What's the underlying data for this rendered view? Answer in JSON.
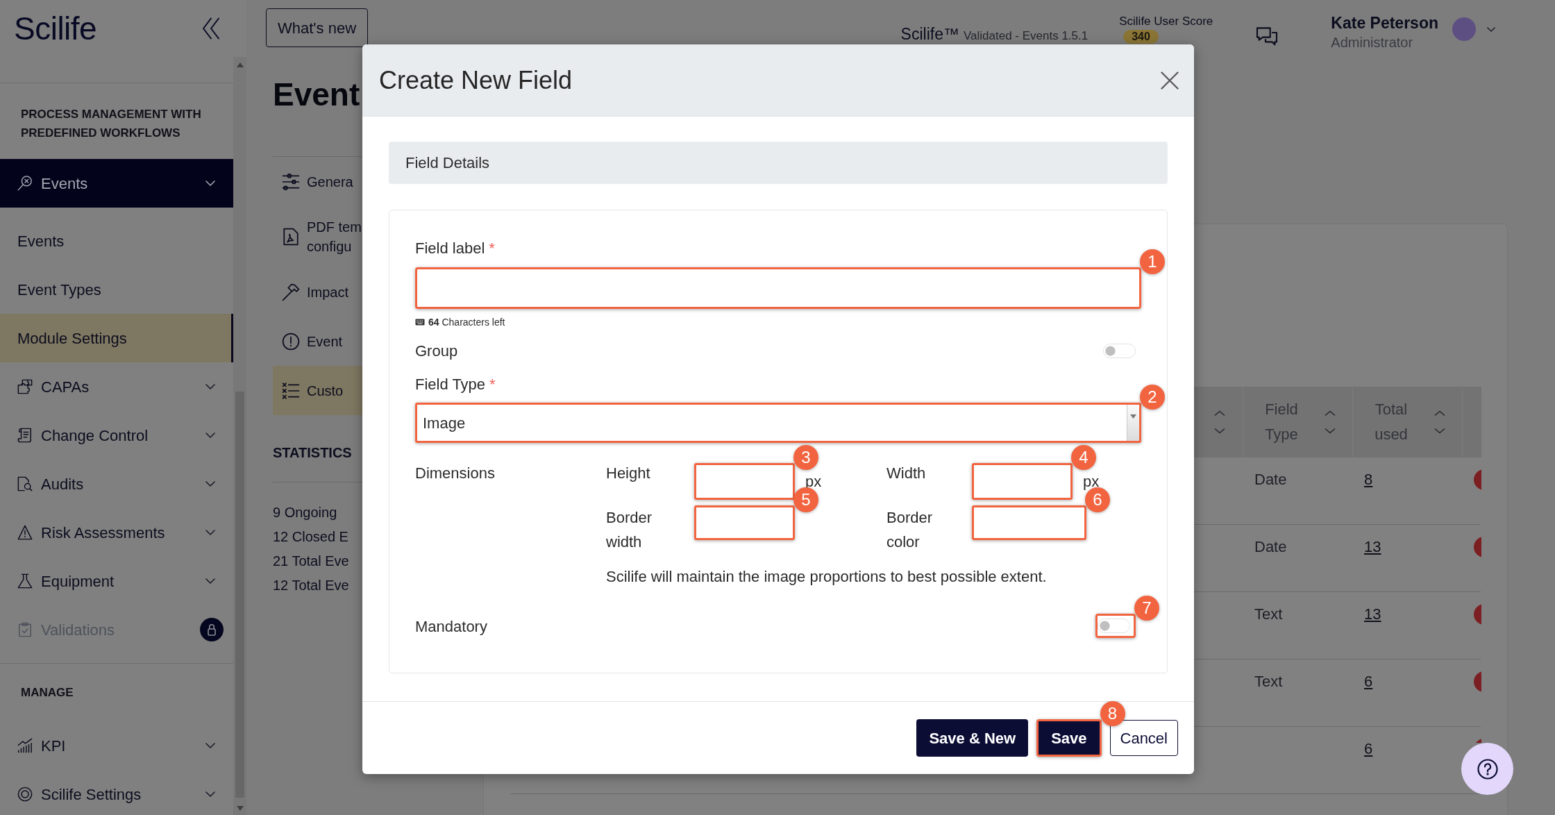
{
  "sidebar": {
    "logo": "Scilife",
    "sections": [
      {
        "title": "PROCESS MANAGEMENT WITH PREDEFINED WORKFLOWS",
        "items": [
          {
            "kind": "module",
            "label": "Events",
            "selected": true,
            "disabled": false
          },
          {
            "kind": "subitem",
            "label": "Events",
            "selected": false,
            "disabled": false
          },
          {
            "kind": "subitem",
            "label": "Event Types",
            "selected": false,
            "disabled": false
          },
          {
            "kind": "subitem",
            "label": "Module Settings",
            "selected": true,
            "disabled": false
          },
          {
            "kind": "module",
            "label": "CAPAs",
            "selected": false,
            "disabled": false
          },
          {
            "kind": "module",
            "label": "Change Control",
            "selected": false,
            "disabled": false
          },
          {
            "kind": "module",
            "label": "Audits",
            "selected": false,
            "disabled": false
          },
          {
            "kind": "module",
            "label": "Risk Assessments",
            "selected": false,
            "disabled": false
          },
          {
            "kind": "module",
            "label": "Equipment",
            "selected": false,
            "disabled": false
          },
          {
            "kind": "locked",
            "label": "Validations",
            "selected": false,
            "disabled": true
          }
        ]
      },
      {
        "title": "MANAGE",
        "items": [
          {
            "kind": "module",
            "label": "KPI",
            "selected": false,
            "disabled": false
          },
          {
            "kind": "module",
            "label": "Scilife Settings",
            "selected": false,
            "disabled": false
          }
        ]
      }
    ]
  },
  "topbar": {
    "whats_new": "What's new",
    "product": "Scilife™",
    "version": "Validated - Events 1.5.1",
    "score_label": "Scilife User Score",
    "score": "340",
    "user": {
      "name": "Kate Peterson",
      "role": "Administrator"
    }
  },
  "page": {
    "title": "Event",
    "nav": [
      {
        "lines": [
          "Genera"
        ],
        "selected": false
      },
      {
        "lines": [
          "PDF tem",
          "configu"
        ],
        "selected": false
      },
      {
        "lines": [
          "Impact"
        ],
        "selected": false
      },
      {
        "lines": [
          "Event"
        ],
        "selected": false
      },
      {
        "lines": [
          "Custo"
        ],
        "selected": true
      }
    ],
    "statistics": {
      "title": "STATISTICS",
      "lines": [
        "9 Ongoing",
        "12 Closed E",
        "21 Total Eve",
        "12 Total Eve"
      ]
    }
  },
  "table": {
    "columns": [
      {
        "label": "Field Type"
      },
      {
        "label": "Total used"
      }
    ],
    "rows": [
      {
        "field_type": "Date",
        "total_used": "8"
      },
      {
        "field_type": "Date",
        "total_used": "13"
      },
      {
        "field_type": "Text",
        "total_used": "13"
      },
      {
        "field_type": "Text",
        "total_used": "6"
      },
      {
        "total_used": "6"
      }
    ]
  },
  "modal": {
    "title": "Create New Field",
    "section_title": "Field Details",
    "field_label": {
      "label": "Field label",
      "required_mark": "*",
      "callout": "1",
      "counter": "**64** Characters left"
    },
    "group": {
      "label": "Group",
      "on": false
    },
    "field_type": {
      "label": "Field Type",
      "required_mark": "*",
      "value": "Image",
      "callout": "2"
    },
    "dimensions": {
      "label": "Dimensions",
      "fields": [
        {
          "label": "Height",
          "unit": "px",
          "callout": "3"
        },
        {
          "label": "Width",
          "unit": "px",
          "callout": "4"
        },
        {
          "label": "Border width",
          "callout": "5"
        },
        {
          "label": "Border color",
          "callout": "6"
        }
      ],
      "note": "Scilife will maintain the image proportions to best possible extent."
    },
    "mandatory": {
      "label": "Mandatory",
      "on": false,
      "callout": "7"
    },
    "buttons": [
      {
        "label": "Save & New",
        "kind": "primary"
      },
      {
        "label": "Save",
        "kind": "primary",
        "callout": "8"
      },
      {
        "label": "Cancel",
        "kind": "secondary"
      }
    ]
  }
}
